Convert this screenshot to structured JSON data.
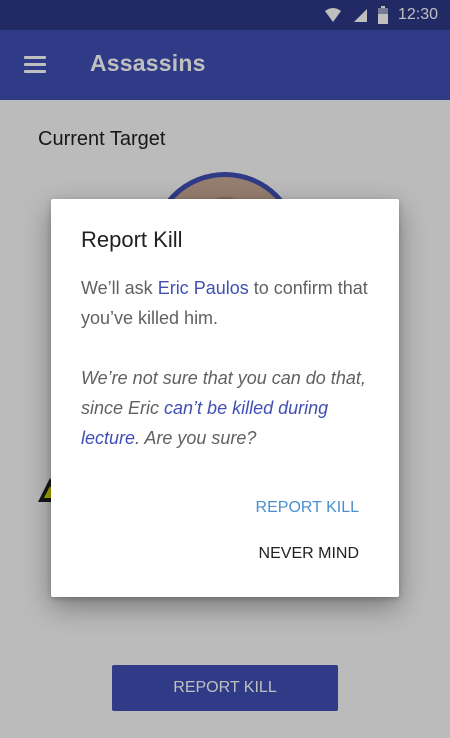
{
  "status_bar": {
    "time": "12:30",
    "icons": [
      "wifi-icon",
      "signal-icon",
      "battery-icon"
    ]
  },
  "app_bar": {
    "title": "Assassins",
    "menu_icon": "menu-icon"
  },
  "main": {
    "section_title": "Current Target",
    "action_button": "REPORT KILL"
  },
  "dialog": {
    "title": "Report Kill",
    "body_prefix": "We’ll ask ",
    "body_name": "Eric Paulos",
    "body_suffix": " to confirm that you’ve killed him.",
    "note_prefix": "We’re not sure that you can do that, since Eric ",
    "note_link": "can’t be killed during lecture",
    "note_suffix": ". Are you sure?",
    "primary_action": "REPORT KILL",
    "secondary_action": "NEVER MIND"
  },
  "colors": {
    "primary": "#3f4fb3",
    "primary_dark": "#2d3986",
    "accent_text": "#4a8fd0"
  }
}
